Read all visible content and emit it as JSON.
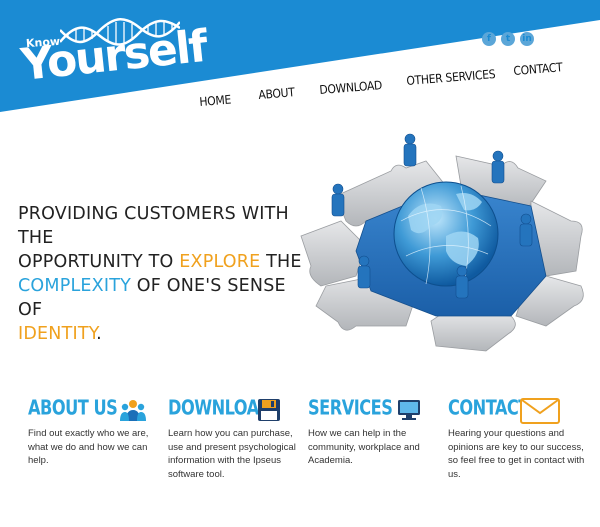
{
  "logo": {
    "small": "Know",
    "main": "Yourself"
  },
  "social": [
    "f",
    "t",
    "in"
  ],
  "nav": {
    "items": [
      {
        "label": "HOME"
      },
      {
        "label": "ABOUT"
      },
      {
        "label": "DOWNLOAD"
      },
      {
        "label": "OTHER SERVICES"
      },
      {
        "label": "CONTACT"
      }
    ]
  },
  "hero": {
    "line1": "PROVIDING CUSTOMERS WITH THE",
    "line2a": "OPPORTUNITY TO ",
    "line2b": "EXPLORE",
    "line2c": " THE",
    "line3a": "COMPLEXITY",
    "line3b": " OF ONE'S SENSE OF",
    "line4a": "IDENTITY",
    "line4b": "."
  },
  "features": [
    {
      "title": "ABOUT US",
      "icon": "people-icon",
      "desc": "Find out exactly who we are, what we do and how we can help."
    },
    {
      "title": "DOWNLOAD",
      "icon": "floppy-disk-icon",
      "desc": "Learn how you can purchase, use and present psychological information with the Ipseus software tool."
    },
    {
      "title": "SERVICES",
      "icon": "monitor-icon",
      "desc": "How we can help in the community, workplace and Academia."
    },
    {
      "title": "CONTACT",
      "icon": "envelope-icon",
      "desc": "Hearing your questions and opinions are key to our success, so feel free to get in contact with us."
    }
  ],
  "colors": {
    "brand_blue": "#1b8bd3",
    "accent_blue": "#2aa3dc",
    "accent_orange": "#f0a11e"
  }
}
